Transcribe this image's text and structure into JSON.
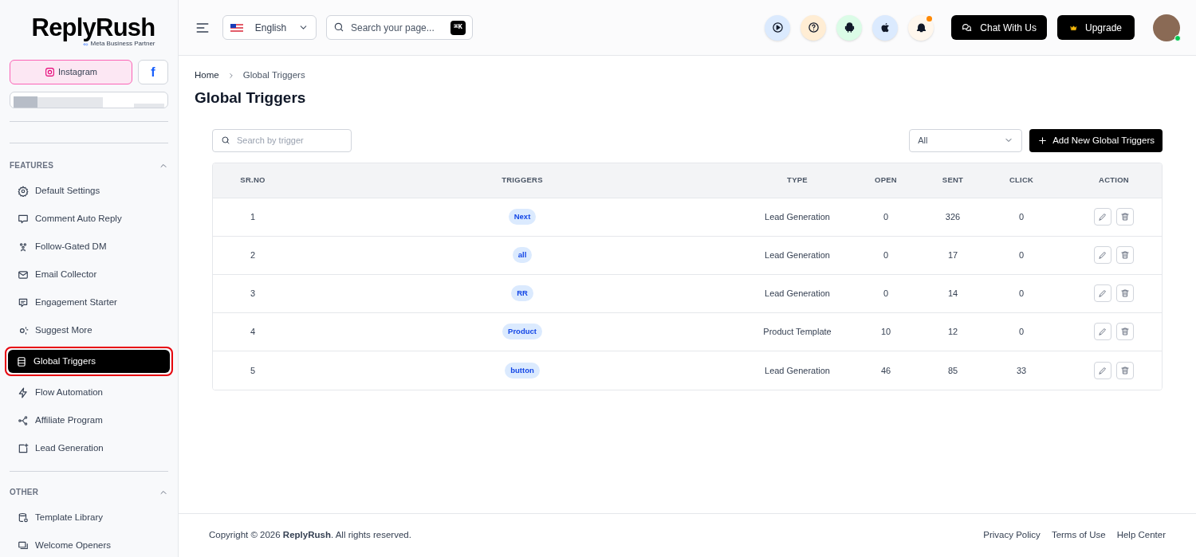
{
  "logo": {
    "name": "ReplyRush",
    "badge": "Meta Business Partner"
  },
  "platform_tabs": [
    {
      "label": "Instagram",
      "selected": true
    },
    {
      "label": "f",
      "selected": false
    }
  ],
  "sidebar": {
    "sections": [
      {
        "title": "FEATURES",
        "expanded": true,
        "items": [
          {
            "label": "Default Settings",
            "selected": false
          },
          {
            "label": "Comment Auto Reply",
            "selected": false
          },
          {
            "label": "Follow-Gated DM",
            "selected": false
          },
          {
            "label": "Email Collector",
            "selected": false
          },
          {
            "label": "Engagement Starter",
            "selected": false
          },
          {
            "label": "Suggest More",
            "selected": false
          },
          {
            "label": "Global Triggers",
            "selected": true
          },
          {
            "label": "Flow Automation",
            "selected": false
          },
          {
            "label": "Affiliate Program",
            "selected": false
          },
          {
            "label": "Lead Generation",
            "selected": false
          }
        ]
      },
      {
        "title": "OTHER",
        "expanded": true,
        "items": [
          {
            "label": "Template Library",
            "selected": false
          },
          {
            "label": "Welcome Openers",
            "selected": false
          }
        ]
      }
    ]
  },
  "header": {
    "language": "English",
    "search": {
      "placeholder": "Search your page...",
      "shortcut": "⌘K"
    },
    "notification_unread": true,
    "buttons": [
      "Chat With Us",
      "Upgrade"
    ],
    "online": true
  },
  "breadcrumb": [
    "Home",
    "Global Triggers"
  ],
  "title": "Global Triggers",
  "toolbar": {
    "search": {
      "placeholder": "Search by trigger"
    },
    "filter": "All",
    "add_button": "Add New Global Triggers"
  },
  "table": {
    "columns": [
      "SR.NO",
      "TRIGGERS",
      "TYPE",
      "OPEN",
      "SENT",
      "CLICK",
      "ACTION"
    ],
    "rows": [
      {
        "sr": "1",
        "trigger": "Next",
        "type": "Lead Generation",
        "open": "0",
        "sent": "326",
        "click": "0"
      },
      {
        "sr": "2",
        "trigger": "all",
        "type": "Lead Generation",
        "open": "0",
        "sent": "17",
        "click": "0"
      },
      {
        "sr": "3",
        "trigger": "RR",
        "type": "Lead Generation",
        "open": "0",
        "sent": "14",
        "click": "0"
      },
      {
        "sr": "4",
        "trigger": "Product",
        "type": "Product Template",
        "open": "10",
        "sent": "12",
        "click": "0"
      },
      {
        "sr": "5",
        "trigger": "button",
        "type": "Lead Generation",
        "open": "46",
        "sent": "85",
        "click": "33"
      }
    ]
  },
  "footer": {
    "copyright": "Copyright © 2026 **ReplyRush**. All rights reserved.",
    "links": [
      "Privacy Policy",
      "Terms of Use",
      "Help Center"
    ]
  }
}
